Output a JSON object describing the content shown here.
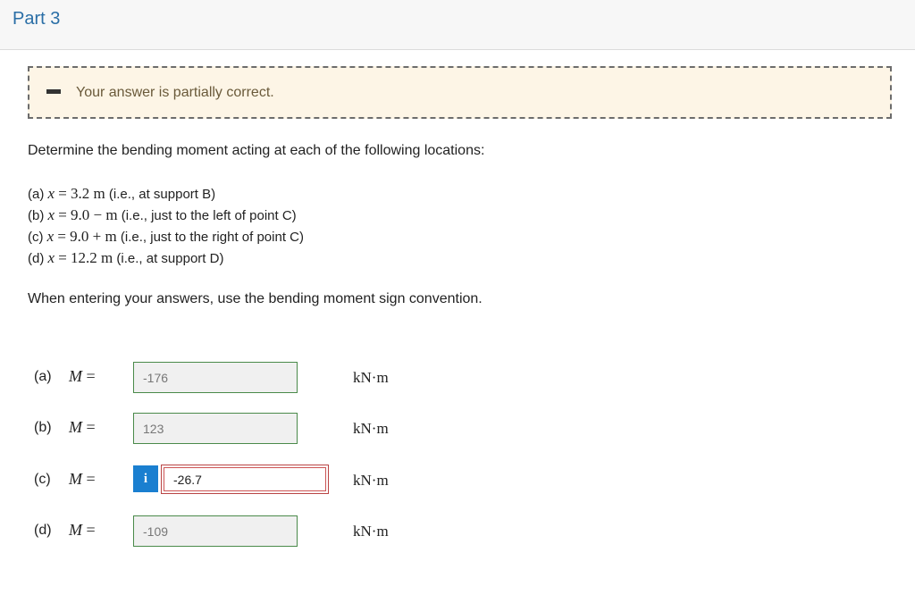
{
  "part": {
    "title": "Part 3"
  },
  "feedback": {
    "text": "Your answer is partially correct."
  },
  "prompt": "Determine the bending moment acting at each of the following locations:",
  "locations": [
    {
      "tag": "(a)",
      "var": "x",
      "eq": "=",
      "value": "3.2 m",
      "desc": "(i.e., at support B)"
    },
    {
      "tag": "(b)",
      "var": "x",
      "eq": "=",
      "value": "9.0 −  m",
      "desc": "(i.e., just to the left of point C)"
    },
    {
      "tag": "(c)",
      "var": "x",
      "eq": "=",
      "value": "9.0 +  m",
      "desc": "(i.e., just to the right of point C)"
    },
    {
      "tag": "(d)",
      "var": "x",
      "eq": "=",
      "value": "12.2 m",
      "desc": "(i.e., at support D)"
    }
  ],
  "note": "When entering your answers, use the bending moment sign convention.",
  "answers": [
    {
      "label": "(a)",
      "var": "M",
      "eq": "=",
      "value": "-176",
      "unit": "kN·m",
      "status": "correct"
    },
    {
      "label": "(b)",
      "var": "M",
      "eq": "=",
      "value": "123",
      "unit": "kN·m",
      "status": "correct"
    },
    {
      "label": "(c)",
      "var": "M",
      "eq": "=",
      "value": "-26.7",
      "unit": "kN·m",
      "status": "incorrect",
      "info_icon": "i"
    },
    {
      "label": "(d)",
      "var": "M",
      "eq": "=",
      "value": "-109",
      "unit": "kN·m",
      "status": "correct"
    }
  ],
  "colors": {
    "correct": "#4a8a4a",
    "incorrect": "#b94444",
    "info": "#1a7fd0",
    "title": "#2a6ea6",
    "feedback_bg": "#fdf5e6"
  }
}
